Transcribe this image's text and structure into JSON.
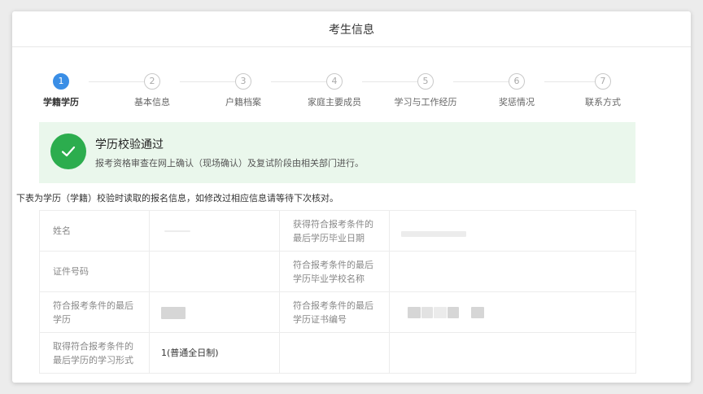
{
  "header": {
    "title": "考生信息"
  },
  "steps": [
    {
      "number": "1",
      "label": "学籍学历",
      "active": true
    },
    {
      "number": "2",
      "label": "基本信息",
      "active": false
    },
    {
      "number": "3",
      "label": "户籍档案",
      "active": false
    },
    {
      "number": "4",
      "label": "家庭主要成员",
      "active": false
    },
    {
      "number": "5",
      "label": "学习与工作经历",
      "active": false
    },
    {
      "number": "6",
      "label": "奖惩情况",
      "active": false
    },
    {
      "number": "7",
      "label": "联系方式",
      "active": false
    }
  ],
  "banner": {
    "title": "学历校验通过",
    "subtitle": "报考资格审查在网上确认（现场确认）及复试阶段由相关部门进行。"
  },
  "note": "下表为学历（学籍）校验时读取的报名信息，如修改过相应信息请等待下次核对。",
  "table": {
    "rows": [
      {
        "label_left": "姓名",
        "value_left": "",
        "label_right": "获得符合报考条件的最后学历毕业日期",
        "value_right": ""
      },
      {
        "label_left": "证件号码",
        "value_left": "",
        "label_right": "符合报考条件的最后学历毕业学校名称",
        "value_right": ""
      },
      {
        "label_left": "符合报考条件的最后学历",
        "value_left": "",
        "label_right": "符合报考条件的最后学历证书编号",
        "value_right": ""
      },
      {
        "label_left": "取得符合报考条件的最后学历的学习形式",
        "value_left": "1(普通全日制)",
        "label_right": "",
        "value_right": ""
      }
    ]
  },
  "colors": {
    "accent": "#3a8ee6",
    "success": "#2cad4e",
    "banner_bg": "#eaf7ec"
  }
}
